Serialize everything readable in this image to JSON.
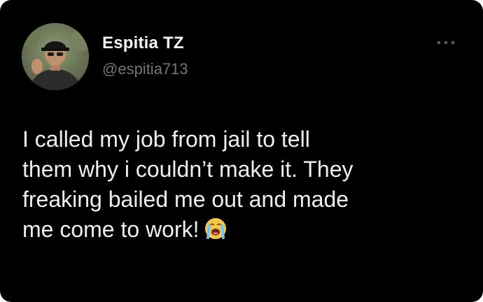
{
  "tweet": {
    "author": {
      "display_name": "Espitia TZ",
      "handle": "@espitia713",
      "avatar_icon": "user-avatar-photo"
    },
    "menu_icon": "more-options-icon",
    "text_lines": [
      "I called my job from jail to tell",
      "them why i couldn’t make it. They",
      "freaking bailed me out and made",
      "me come to work!"
    ],
    "emoji": "loudly-crying-face-emoji",
    "colors": {
      "background": "#000000",
      "text": "#eceeef",
      "handle": "#71767b"
    }
  }
}
